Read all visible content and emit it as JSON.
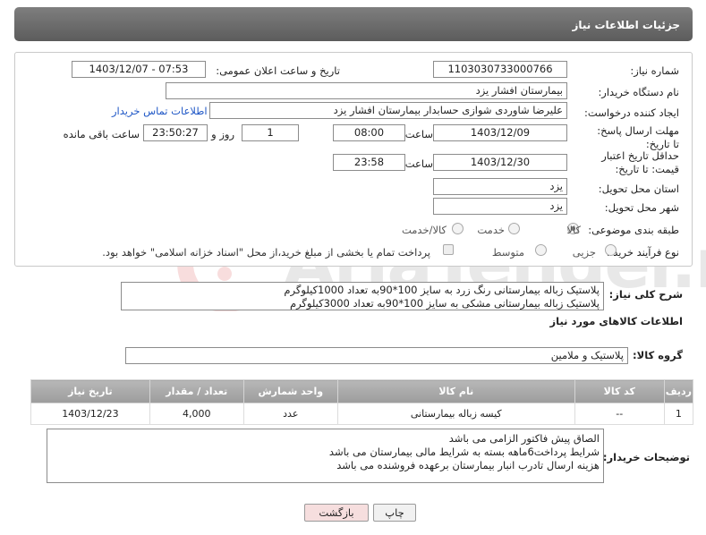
{
  "header": {
    "title": "جزئیات اطلاعات نیاز"
  },
  "fields": {
    "need_number_label": "شماره نیاز:",
    "need_number": "1103030733000766",
    "announce_label": "تاریخ و ساعت اعلان عمومی:",
    "announce_value": "1403/12/07 - 07:53",
    "buyer_org_label": "نام دستگاه خریدار:",
    "buyer_org": "بیمارستان افشار یزد",
    "creator_label": "ایجاد کننده درخواست:",
    "creator": "علیرضا شاوردی شوازی حسابدار بیمارستان افشار یزد",
    "contact_link": "اطلاعات تماس خریدار",
    "deadline_label": "مهلت ارسال پاسخ: تا تاریخ:",
    "deadline_date": "1403/12/09",
    "hour_label": "ساعت",
    "deadline_time": "08:00",
    "days_value": "1",
    "days_label": "روز و",
    "remaining_time": "23:50:27",
    "remaining_label": "ساعت باقی مانده",
    "validity_label": "حداقل تاریخ اعتبار قیمت: تا تاریخ:",
    "validity_date": "1403/12/30",
    "validity_time": "23:58",
    "province_label": "استان محل تحویل:",
    "province": "یزد",
    "city_label": "شهر محل تحویل:",
    "city": "یزد",
    "category_label": "طبقه بندی موضوعی:",
    "category_options": [
      "کالا",
      "خدمت",
      "کالا/خدمت"
    ],
    "process_label": "نوع فرآیند خرید :",
    "process_options": [
      "جزیی",
      "متوسط"
    ],
    "payment_note": "پرداخت تمام یا بخشی از مبلغ خرید،از محل \"اسناد خزانه اسلامی\" خواهد بود."
  },
  "description": {
    "label": "شرح کلی نیاز:",
    "lines": [
      "پلاستیک زباله بیمارستانی رنگ زرد به سایز 100*90به تعداد 1000کیلوگرم",
      "پلاستیک زباله بیمارستانی مشکی به سایز 100*90به تعداد 3000کیلوگرم"
    ]
  },
  "goods": {
    "section_title": "اطلاعات کالاهای مورد نیاز",
    "group_label": "گروه کالا:",
    "group_value": "پلاستیک و ملامین",
    "columns": [
      "ردیف",
      "کد کالا",
      "نام کالا",
      "واحد شمارش",
      "تعداد / مقدار",
      "تاریخ نیاز"
    ],
    "rows": [
      {
        "row": "1",
        "code": "--",
        "name": "کیسه زباله بیمارستانی",
        "unit": "عدد",
        "qty": "4,000",
        "date": "1403/12/23"
      }
    ]
  },
  "buyer_notes": {
    "label": "توضیحات خریدار:",
    "lines": [
      "الصاق پیش فاکتور الزامی می باشد",
      "شرایط پرداخت6ماهه بسته به شرایط مالی بیمارستان می باشد",
      "هزینه ارسال تادرب انبار بیمارستان برعهده فروشنده می باشد"
    ]
  },
  "buttons": {
    "print": "چاپ",
    "back": "بازگشت"
  },
  "watermark": {
    "text": "AriaTender.neT"
  },
  "colors": {
    "header": "#6b6b6b",
    "link": "#1f57c6",
    "back_button_bg": "#f6dede"
  }
}
